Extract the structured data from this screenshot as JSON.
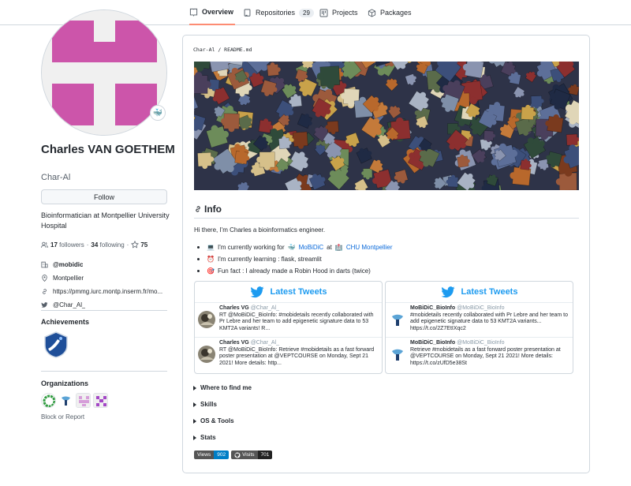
{
  "tabs": [
    {
      "label": "Overview",
      "icon": "book-icon",
      "active": true
    },
    {
      "label": "Repositories",
      "icon": "repo-icon",
      "count": "29"
    },
    {
      "label": "Projects",
      "icon": "project-icon"
    },
    {
      "label": "Packages",
      "icon": "package-icon"
    }
  ],
  "profile": {
    "name": "Charles VAN GOETHEM",
    "login": "Char-Al",
    "status_emoji": "🐳",
    "follow_label": "Follow",
    "bio": "Bioinformatician at Montpellier University Hospital",
    "followers_count": "17",
    "followers_label": "followers",
    "following_count": "34",
    "following_label": "following",
    "stars_count": "75",
    "company": "@mobidic",
    "location": "Montpellier",
    "website": "https://pmmg.iurc.montp.inserm.fr/mo...",
    "twitter": "@Char_Al_"
  },
  "achievements": {
    "title": "Achievements"
  },
  "organizations": {
    "title": "Organizations",
    "block_report": "Block or Report"
  },
  "readme": {
    "path_user": "Char-Al",
    "path_sep": "/",
    "path_file": "README.md",
    "heading": "Info",
    "intro": "Hi there, I'm Charles a bioinformatics engineer.",
    "bullet1_emoji": "💻",
    "bullet1_pre": "I'm currently working for",
    "bullet1_link1_emoji": "🐳",
    "bullet1_link1": "MoBiDiC",
    "bullet1_mid": "at",
    "bullet1_link2_emoji": "🏥",
    "bullet1_link2": "CHU Montpellier",
    "bullet2_emoji": "⏰",
    "bullet2": "I'm currently learning : flask, streamlit",
    "bullet3_emoji": "🎯",
    "bullet3": "Fun fact : I already made a Robin Hood in darts (twice)"
  },
  "tweets_left": {
    "title": "Latest Tweets",
    "items": [
      {
        "user": "Charles VG",
        "handle": "@Char_Al_",
        "text": "RT @MoBiDiC_BioInfo: #mobidetails recently collaborated with Pr Lebre and her team to add epigenetic signature data to 53 KMT2A variants! R..."
      },
      {
        "user": "Charles VG",
        "handle": "@Char_Al_",
        "text": "RT @MoBiDiC_BioInfo: Retrieve #mobidetails as a fast forward poster presentation at @VEPTCOURSE on Monday, Sept 21 2021! More details: http..."
      }
    ]
  },
  "tweets_right": {
    "title": "Latest Tweets",
    "items": [
      {
        "user": "MoBiDiC_BioInfo",
        "handle": "@MoBiDiC_BioInfo",
        "text": "#mobidetails recently collaborated with Pr Lebre and her team to add epigenetic signature data to 53 KMT2A variants... https://t.co/2Z7EtIXqc2"
      },
      {
        "user": "MoBiDiC_BioInfo",
        "handle": "@MoBiDiC_BioInfo",
        "text": "Retrieve #mobidetails as a fast forward poster presentation at @VEPTCOURSE on Monday, Sept 21 2021! More details: https://t.co/zUfD5e38St"
      }
    ]
  },
  "sections": [
    "Where to find me",
    "Skills",
    "OS & Tools",
    "Stats"
  ],
  "badges": [
    {
      "label": "Views",
      "value": "902",
      "color": "#007ec6"
    },
    {
      "label": "Visits",
      "value": "701",
      "color": "#222222"
    }
  ],
  "colors": {
    "accent_tab": "#fd8c73",
    "link": "#0969da",
    "twitter": "#1d9bf0",
    "avatar_magenta": "#cc55aa"
  }
}
